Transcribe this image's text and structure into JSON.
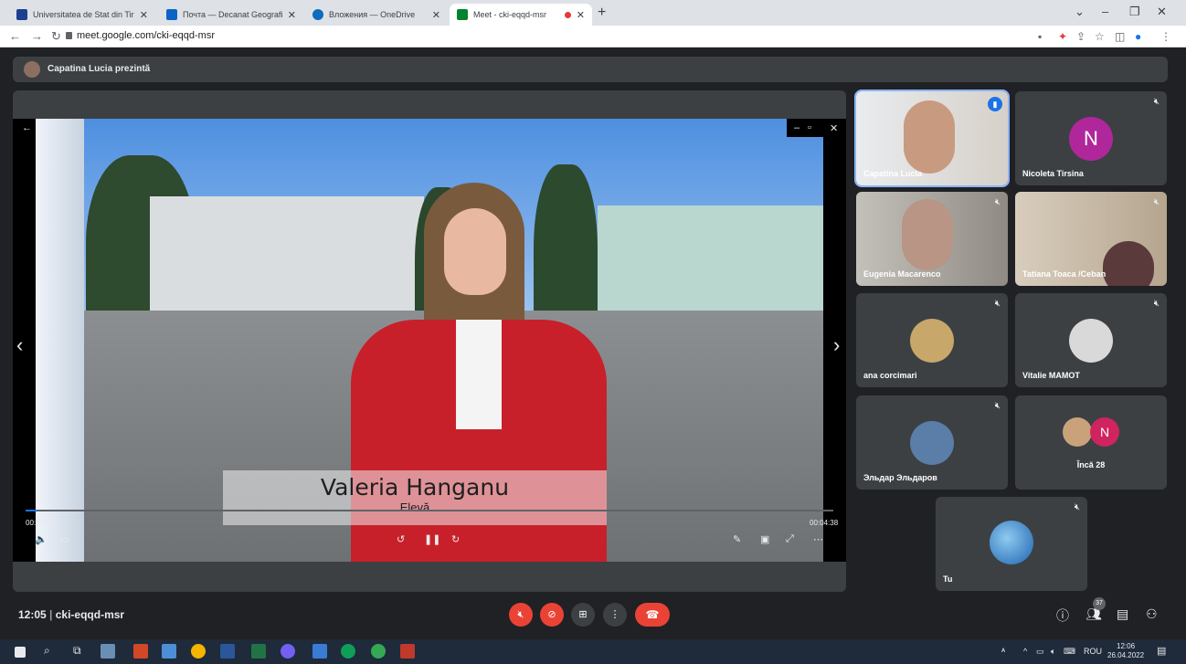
{
  "browser": {
    "tabs": [
      {
        "title": "Universitatea de Stat din Tiraspol",
        "favicon_color": "#1c3f8f"
      },
      {
        "title": "Почта — Decanat Geografie — C",
        "favicon_color": "#0a64c8"
      },
      {
        "title": "Вложения — OneDrive",
        "favicon_color": "#0f6cbd"
      },
      {
        "title": "Meet - cki-eqqd-msr",
        "favicon_color": "#00832d"
      }
    ],
    "new_tab": "+",
    "url": "meet.google.com/cki-eqqd-msr"
  },
  "meet": {
    "presenter_banner": "Capatina Lucia prezintă",
    "video": {
      "caption_name": "Valeria Hanganu",
      "caption_role": "Elevă",
      "time_current": "00:00:05",
      "time_total": "00:04:38",
      "progress_fraction": 0.015
    },
    "participants": [
      {
        "name": "Capatina Lucia",
        "speaking": true
      },
      {
        "name": "Nicoleta Tirsina",
        "initial": "N",
        "avatar_color": "#b0279c"
      },
      {
        "name": "Eugenia Macarenco"
      },
      {
        "name": "Tatiana Toaca /Ceban"
      },
      {
        "name": "ana corcimari"
      },
      {
        "name": "Vitalie MAMOT"
      },
      {
        "name": "Эльдар Эльдаров"
      },
      {
        "name": "Încă 28",
        "initial": "N",
        "avatar_color": "#d0245f"
      },
      {
        "name": "Tu"
      }
    ],
    "meeting_time": "12:05",
    "meeting_code": "cki-eqqd-msr",
    "participant_count": "37"
  },
  "taskbar": {
    "language": "ROU",
    "time": "12:06",
    "date": "26.04.2022"
  }
}
